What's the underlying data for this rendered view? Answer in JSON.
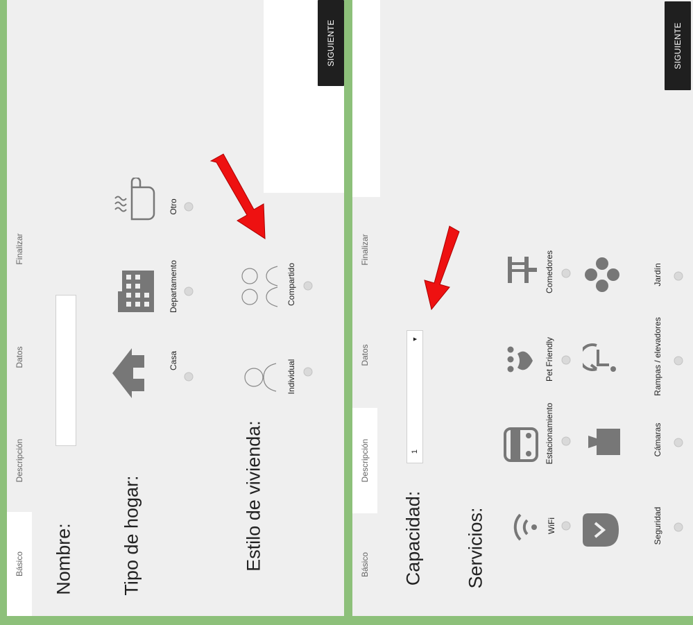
{
  "tabs": [
    "Básico",
    "Descripción",
    "Datos",
    "Finalizar"
  ],
  "next_label": "SIGUIENTE",
  "left": {
    "nombre_label": "Nombre:",
    "nombre_value": "",
    "tipo_hogar_label": "Tipo de hogar:",
    "tipo_hogar_options": [
      "Casa",
      "Departamento",
      "Otro"
    ],
    "estilo_label": "Estilo de vivienda:",
    "estilo_options": [
      "Individual",
      "Compartido"
    ]
  },
  "right": {
    "capacidad_label": "Capacidad:",
    "capacidad_value": "1",
    "servicios_label": "Servicios:",
    "servicios": [
      "WiFi",
      "Estacionamiento",
      "Pet Friendly",
      "Comedores",
      "Seguridad",
      "Cámaras",
      "Rampas / elevadores",
      "Jardín"
    ]
  },
  "colors": {
    "background": "#8dc07a",
    "panel": "#efefef",
    "icon": "#777777",
    "arrow": "#ee1111",
    "button": "#1f1f1f"
  }
}
